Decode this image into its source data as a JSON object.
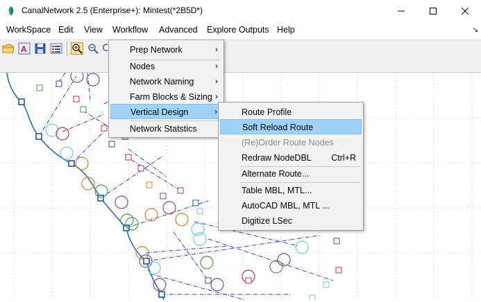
{
  "window": {
    "title": "CanalNetwork 2.5  (Enterprise+): Mintest(*2B5D*)",
    "minimize_glyph": "—",
    "maximize_glyph": "☐",
    "close_glyph": "✕"
  },
  "menubar": {
    "items": [
      "WorkSpace",
      "Edit",
      "View",
      "Workflow",
      "Advanced",
      "Explore Outputs",
      "Help"
    ],
    "corner_glyph": "↘"
  },
  "toolbar": {
    "icons": [
      "open-folder-icon",
      "text-a-icon",
      "save-icon",
      "list-icon",
      "zoom-in-icon",
      "zoom-icon"
    ]
  },
  "workflow_menu": {
    "items": [
      {
        "label": "Prep Network",
        "arrow": "›"
      },
      {
        "label": "Nodes",
        "arrow": "›"
      },
      {
        "label": "Network Naming",
        "arrow": "›"
      },
      {
        "label": "Farm Blocks & Sizing",
        "arrow": "›"
      },
      {
        "label": "Vertical Design",
        "arrow": "›"
      },
      {
        "label": "Network Statstics",
        "arrow": ""
      }
    ]
  },
  "vertical_design_menu": {
    "items": [
      {
        "label": "Route Profile",
        "shortcut": ""
      },
      {
        "label": "Soft Reload Route",
        "shortcut": ""
      },
      {
        "label": "(Re)Order Route Nodes",
        "shortcut": ""
      },
      {
        "label": "Redraw NodeDBL",
        "shortcut": "Ctrl+R"
      },
      {
        "label": "Alternate Route...",
        "shortcut": ""
      },
      {
        "label": "Table MBL, MTL...",
        "shortcut": ""
      },
      {
        "label": "AutoCAD MBL, MTL ...",
        "shortcut": ""
      },
      {
        "label": "Digitize LSec",
        "shortcut": ""
      }
    ]
  },
  "colors": {
    "highlight": "#9fd3f7",
    "canal_line": "#1f6fc0",
    "lateral_line": "#2a3fd6",
    "node_box": "#2255aa",
    "circle_purple": "#8a3fa8",
    "circle_orange": "#e07a1a",
    "circle_green": "#3f9f3f",
    "circle_cyan": "#6fc9e8",
    "box_red": "#c0304a",
    "grid": "#c9c9c9"
  }
}
